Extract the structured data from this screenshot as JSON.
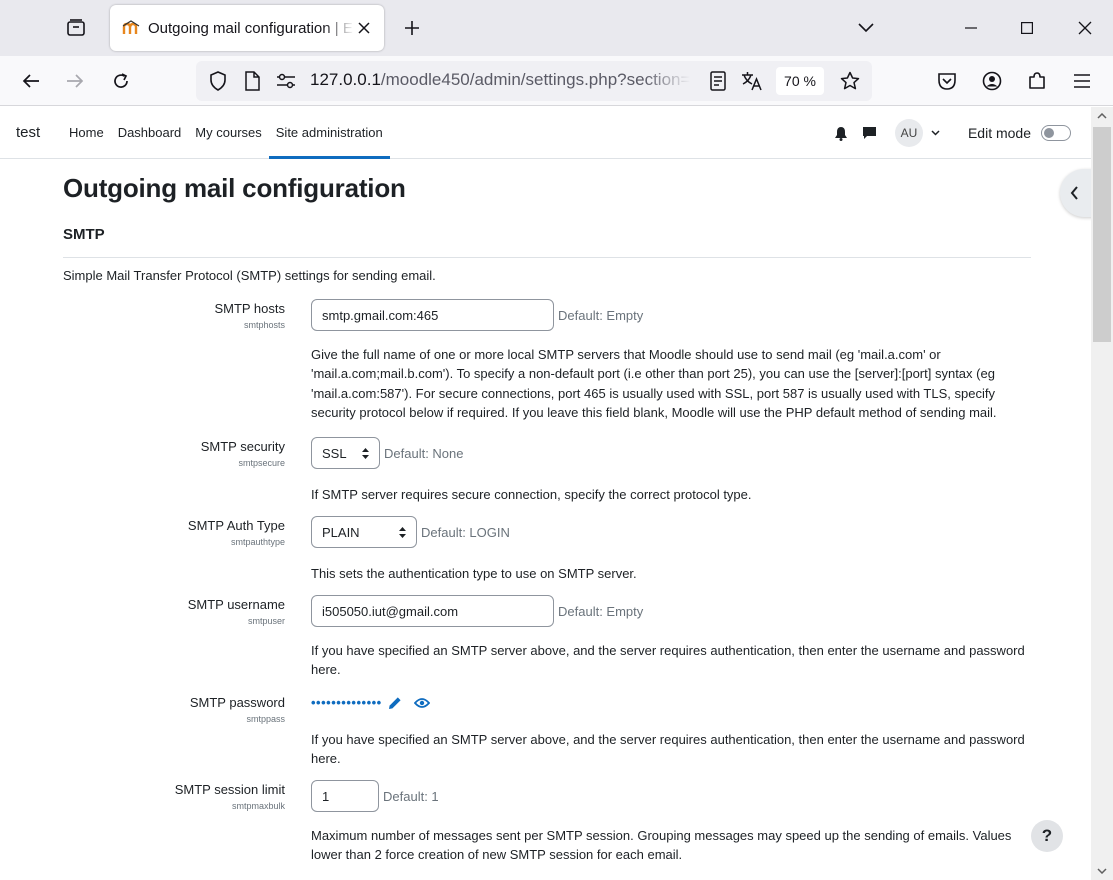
{
  "browser": {
    "tab_title": "Outgoing mail configuration | E",
    "url_host": "127.0.0.1",
    "url_path": "/moodle450/admin/settings.php?section=",
    "zoom": "70 %"
  },
  "site": {
    "name": "test",
    "nav": [
      "Home",
      "Dashboard",
      "My courses",
      "Site administration"
    ],
    "active_nav": "Site administration",
    "user_initials": "AU",
    "edit_mode_label": "Edit mode",
    "edit_mode_on": false
  },
  "page": {
    "title": "Outgoing mail configuration",
    "section_title": "SMTP",
    "section_description": "Simple Mail Transfer Protocol (SMTP) settings for sending email."
  },
  "settings": {
    "smtphosts": {
      "label": "SMTP hosts",
      "key": "smtphosts",
      "value": "smtp.gmail.com:465",
      "default": "Default: Empty",
      "help": "Give the full name of one or more local SMTP servers that Moodle should use to send mail (eg 'mail.a.com' or 'mail.a.com;mail.b.com'). To specify a non-default port (i.e other than port 25), you can use the [server]:[port] syntax (eg 'mail.a.com:587'). For secure connections, port 465 is usually used with SSL, port 587 is usually used with TLS, specify security protocol below if required. If you leave this field blank, Moodle will use the PHP default method of sending mail."
    },
    "smtpsecure": {
      "label": "SMTP security",
      "key": "smtpsecure",
      "value": "SSL",
      "default": "Default: None",
      "help": "If SMTP server requires secure connection, specify the correct protocol type."
    },
    "smtpauthtype": {
      "label": "SMTP Auth Type",
      "key": "smtpauthtype",
      "value": "PLAIN",
      "default": "Default: LOGIN",
      "help": "This sets the authentication type to use on SMTP server."
    },
    "smtpuser": {
      "label": "SMTP username",
      "key": "smtpuser",
      "value": "i505050.iut@gmail.com",
      "default": "Default: Empty",
      "help": "If you have specified an SMTP server above, and the server requires authentication, then enter the username and password here."
    },
    "smtppass": {
      "label": "SMTP password",
      "key": "smtppass",
      "masked_value": "••••••••••••••",
      "help": "If you have specified an SMTP server above, and the server requires authentication, then enter the username and password here."
    },
    "smtpmaxbulk": {
      "label": "SMTP session limit",
      "key": "smtpmaxbulk",
      "value": "1",
      "default": "Default: 1",
      "help": "Maximum number of messages sent per SMTP session. Grouping messages may speed up the sending of emails. Values lower than 2 force creation of new SMTP session for each email."
    }
  },
  "help_button": "?",
  "colors": {
    "accent": "#0f6cbf",
    "text": "#1d2125",
    "muted": "#6a737b"
  },
  "icons": [
    "tab-group-icon",
    "moodle-favicon",
    "close-icon",
    "plus-icon",
    "chevron-down-icon",
    "minimize-icon",
    "maximize-icon",
    "window-close-icon",
    "back-arrow-icon",
    "forward-arrow-icon",
    "reload-icon",
    "shield-icon",
    "page-icon",
    "permissions-icon",
    "reader-view-icon",
    "translate-icon",
    "star-icon",
    "pocket-icon",
    "account-icon",
    "extensions-icon",
    "menu-icon",
    "bell-icon",
    "chat-icon",
    "pencil-icon",
    "eye-icon",
    "chevron-left-icon"
  ]
}
